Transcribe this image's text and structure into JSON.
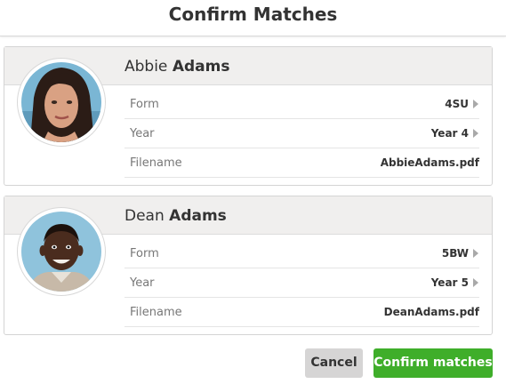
{
  "modal": {
    "title": "Confirm Matches"
  },
  "matches": [
    {
      "first_name": "Abbie",
      "last_name": "Adams",
      "avatar_icon": "student-photo-icon",
      "fields": [
        {
          "label": "Form",
          "value": "4SU"
        },
        {
          "label": "Year",
          "value": "Year 4"
        },
        {
          "label": "Filename",
          "value": "AbbieAdams.pdf"
        }
      ]
    },
    {
      "first_name": "Dean",
      "last_name": "Adams",
      "avatar_icon": "student-photo-icon",
      "fields": [
        {
          "label": "Form",
          "value": "5BW"
        },
        {
          "label": "Year",
          "value": "Year 5"
        },
        {
          "label": "Filename",
          "value": "DeanAdams.pdf"
        }
      ]
    }
  ],
  "actions": {
    "cancel_label": "Cancel",
    "confirm_label": "Confirm matches"
  },
  "colors": {
    "confirm": "#3fae2a",
    "cancel": "#d6d5d5",
    "card_header": "#f0efee"
  }
}
